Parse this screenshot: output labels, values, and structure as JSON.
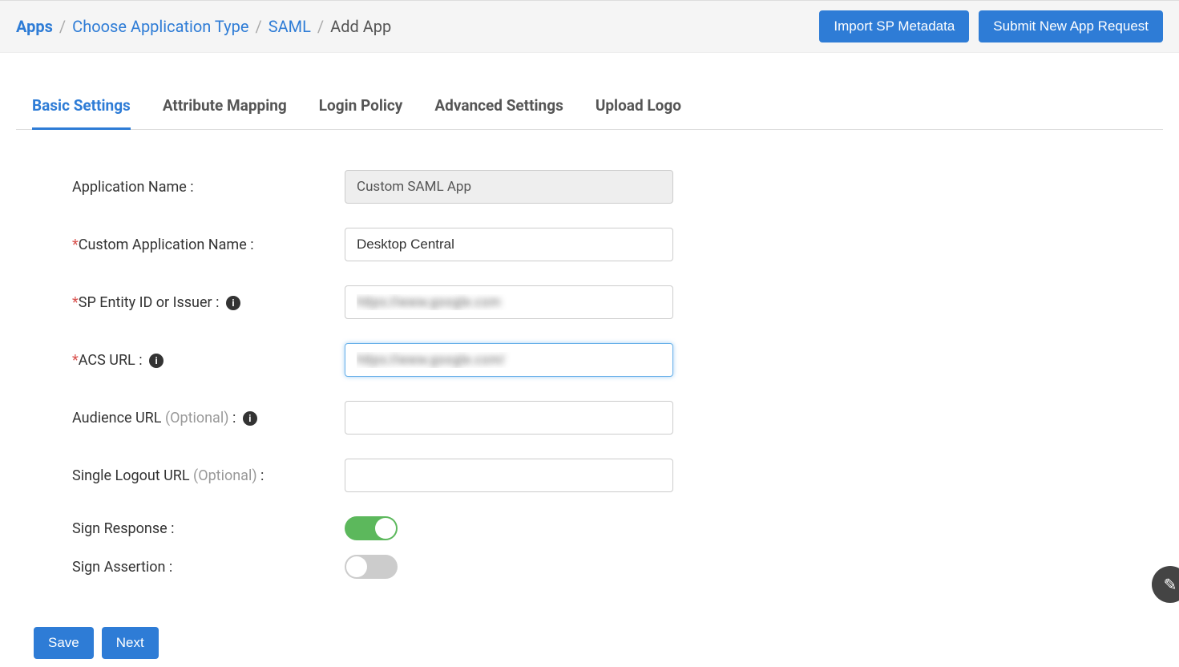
{
  "breadcrumb": {
    "apps": "Apps",
    "choose_type": "Choose Application Type",
    "saml": "SAML",
    "current": "Add App"
  },
  "header_actions": {
    "import": "Import SP Metadata",
    "submit": "Submit New App Request"
  },
  "tabs": {
    "basic": "Basic Settings",
    "attribute": "Attribute Mapping",
    "login": "Login Policy",
    "advanced": "Advanced Settings",
    "logo": "Upload Logo"
  },
  "form": {
    "app_name_label": "Application Name :",
    "app_name_value": "Custom SAML App",
    "custom_name_label": "Custom Application Name :",
    "custom_name_value": "Desktop Central",
    "sp_entity_label": "SP Entity ID or Issuer :",
    "sp_entity_value": "https://www.google.com",
    "acs_label": "ACS URL :",
    "acs_value": "https://www.google.com/",
    "audience_label": "Audience URL ",
    "audience_value": "",
    "slo_label": "Single Logout URL ",
    "slo_value": "",
    "optional": "(Optional)",
    "colon": " :",
    "sign_response_label": "Sign Response :",
    "sign_assertion_label": "Sign Assertion :"
  },
  "footer": {
    "save": "Save",
    "next": "Next"
  }
}
